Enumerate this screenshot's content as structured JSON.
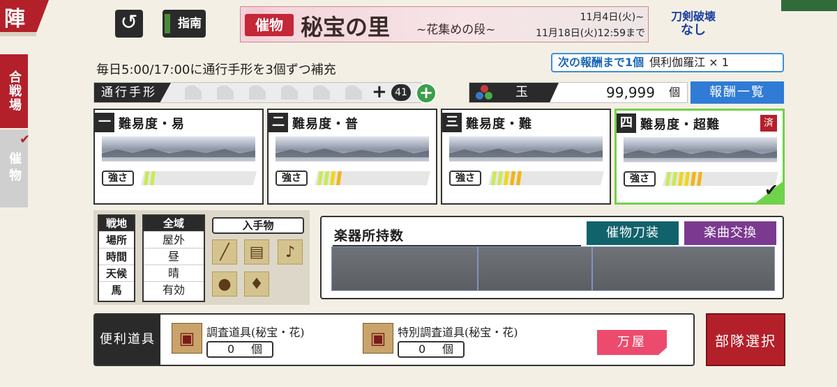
{
  "header": {
    "corner_title": "陣",
    "back_icon": "↺",
    "guide_label": "指南",
    "banner": {
      "tag": "催物",
      "title": "秘宝の里",
      "subtitle": "~花集めの段~",
      "date_line1": "11月4日(火)~",
      "date_line2": "11月18日(火)12:59まで"
    },
    "break_status_line1": "刀剣破壊",
    "break_status_line2": "なし"
  },
  "side_tabs": {
    "battle": "合戦場",
    "event": "催物",
    "check_icon": "✔"
  },
  "info": {
    "notice": "毎日5:00/17:00に通行手形を3個ずつ補充",
    "next_reward_label": "次の報酬まで1個",
    "next_reward_item": "倶利伽羅江 × 1",
    "pass_label": "通行手形",
    "pass_plus": "+",
    "pass_count": "41",
    "add_pass_icon": "+",
    "gem_label": "玉",
    "gem_value": "99,999",
    "gem_unit": "個",
    "reward_list_button": "報酬一覧"
  },
  "difficulties": [
    {
      "num": "一",
      "name": "難易度・易",
      "strength_label": "強さ",
      "strength": 2,
      "badge": "",
      "completed": false
    },
    {
      "num": "二",
      "name": "難易度・普",
      "strength_label": "強さ",
      "strength": 4,
      "badge": "",
      "completed": false
    },
    {
      "num": "三",
      "name": "難易度・難",
      "strength_label": "強さ",
      "strength": 5,
      "badge": "",
      "completed": false
    },
    {
      "num": "四",
      "name": "難易度・超難",
      "strength_label": "強さ",
      "strength": 6,
      "badge": "済",
      "completed": true
    }
  ],
  "strength_max": 12,
  "colors": {
    "strength_green": "#c9ea57",
    "strength_yellow": "#f3d51a",
    "strength_orange": "#f0b51a",
    "accent_red": "#b3202a",
    "accent_blue": "#2f7bd6",
    "complete_green": "#6fd34a"
  },
  "filters": {
    "headers": [
      "戦地",
      "全域"
    ],
    "rows": [
      {
        "label": "場所",
        "value": "屋外"
      },
      {
        "label": "時間",
        "value": "昼"
      },
      {
        "label": "天候",
        "value": "晴"
      },
      {
        "label": "馬",
        "value": "有効"
      }
    ],
    "loot_header": "入手物",
    "loot_icons": [
      "flute-icon",
      "koto-icon",
      "shamisen-icon",
      "drum-icon",
      "bell-icon"
    ]
  },
  "instruments": {
    "title": "楽器所持数",
    "sword_button": "催物刀装",
    "music_button": "楽曲交換"
  },
  "tools": {
    "label": "便利道具",
    "items": [
      {
        "name": "調査道具(秘宝・花)",
        "count": "0",
        "unit": "個"
      },
      {
        "name": "特別調査道具(秘宝・花)",
        "count": "0",
        "unit": "個"
      }
    ],
    "shop_button": "万屋"
  },
  "party_button": "部隊選択"
}
